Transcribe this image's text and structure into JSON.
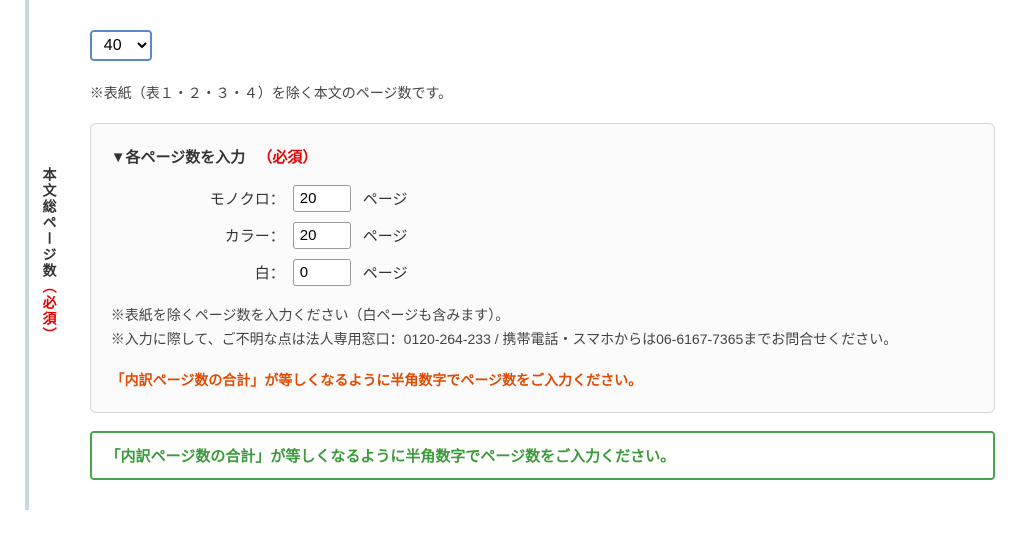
{
  "sidebar": {
    "label": "本文総ページ数",
    "required": "（必須）"
  },
  "pageSelect": {
    "value": "40"
  },
  "note1": "※表紙（表１・２・３・４）を除く本文のページ数です。",
  "panel": {
    "titleMark": "▼",
    "title": "各ページ数を入力",
    "required": "（必須）",
    "fields": {
      "mono": {
        "label": "モノクロ：",
        "value": "20",
        "unit": "ページ"
      },
      "color": {
        "label": "カラー：",
        "value": "20",
        "unit": "ページ"
      },
      "white": {
        "label": "白：",
        "value": "0",
        "unit": "ページ"
      }
    },
    "note2": "※表紙を除くページ数を入力ください（白ページも含みます）。",
    "note3": "※入力に際して、ご不明な点は法人専用窓口：0120-264-233 / 携帯電話・スマホからは06-6167-7365までお問合せください。",
    "warn": "「内訳ページ数の合計」が等しくなるように半角数字でページ数をご入力ください。"
  },
  "alert": "「内訳ページ数の合計」が等しくなるように半角数字でページ数をご入力ください。"
}
